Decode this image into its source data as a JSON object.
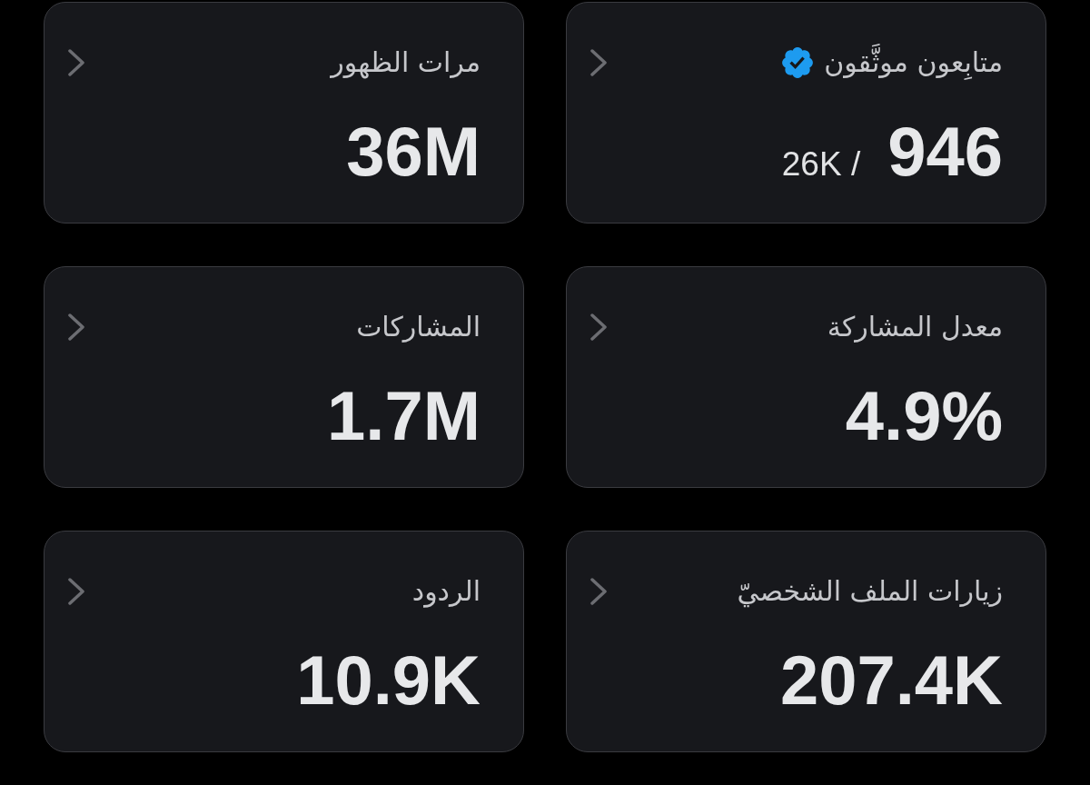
{
  "cards": [
    {
      "label": "متابِعون موثَّقون",
      "verified": true,
      "value": "946",
      "total": "26K /"
    },
    {
      "label": "مرات الظهور",
      "verified": false,
      "value": "36M"
    },
    {
      "label": "معدل المشاركة",
      "verified": false,
      "value": "4.9%"
    },
    {
      "label": "المشاركات",
      "verified": false,
      "value": "1.7M"
    },
    {
      "label": "زيارات الملف الشخصيّ",
      "verified": false,
      "value": "207.4K"
    },
    {
      "label": "الردود",
      "verified": false,
      "value": "10.9K"
    }
  ]
}
